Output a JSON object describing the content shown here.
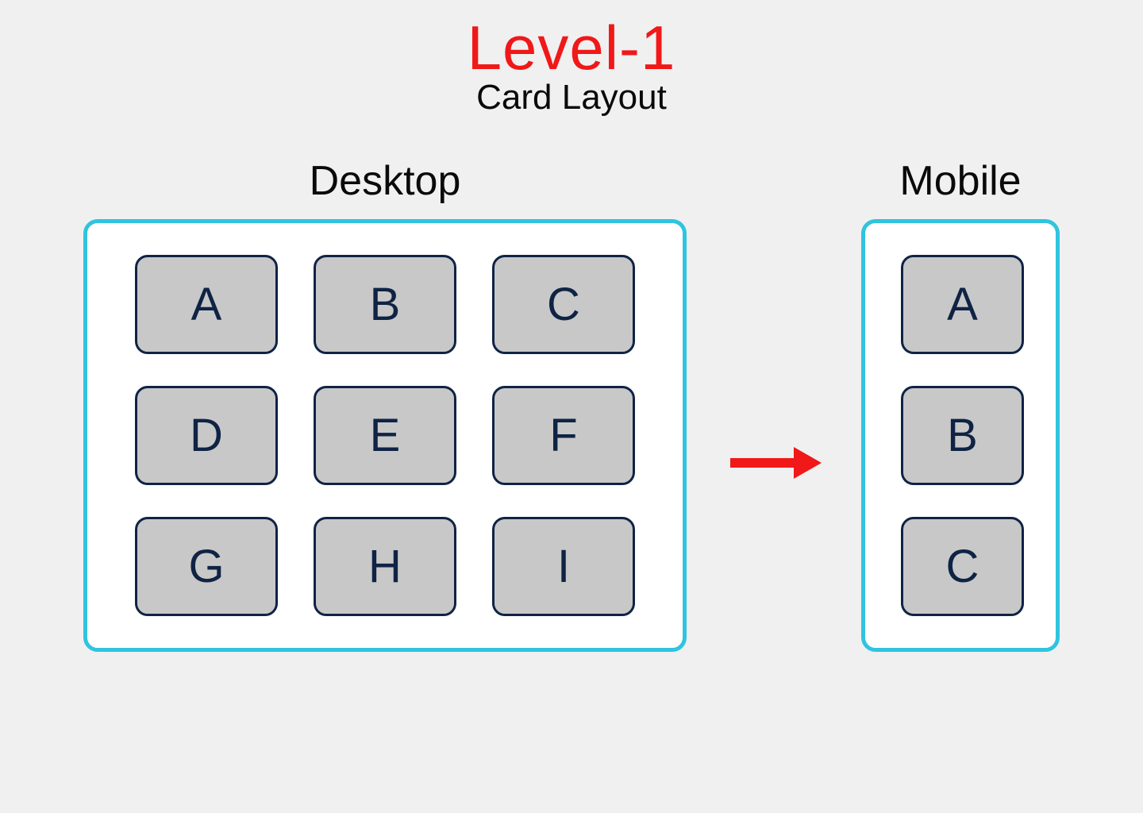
{
  "header": {
    "level": "Level-1",
    "subtitle": "Card Layout"
  },
  "sections": {
    "desktop": {
      "title": "Desktop",
      "cards": [
        "A",
        "B",
        "C",
        "D",
        "E",
        "F",
        "G",
        "H",
        "I"
      ]
    },
    "mobile": {
      "title": "Mobile",
      "cards": [
        "A",
        "B",
        "C"
      ]
    }
  },
  "colors": {
    "title_red": "#f01818",
    "frame_border": "#2fc4df",
    "card_bg": "#c8c8c8",
    "card_border": "#0f2344",
    "card_text": "#0f2344",
    "arrow": "#f01818"
  }
}
